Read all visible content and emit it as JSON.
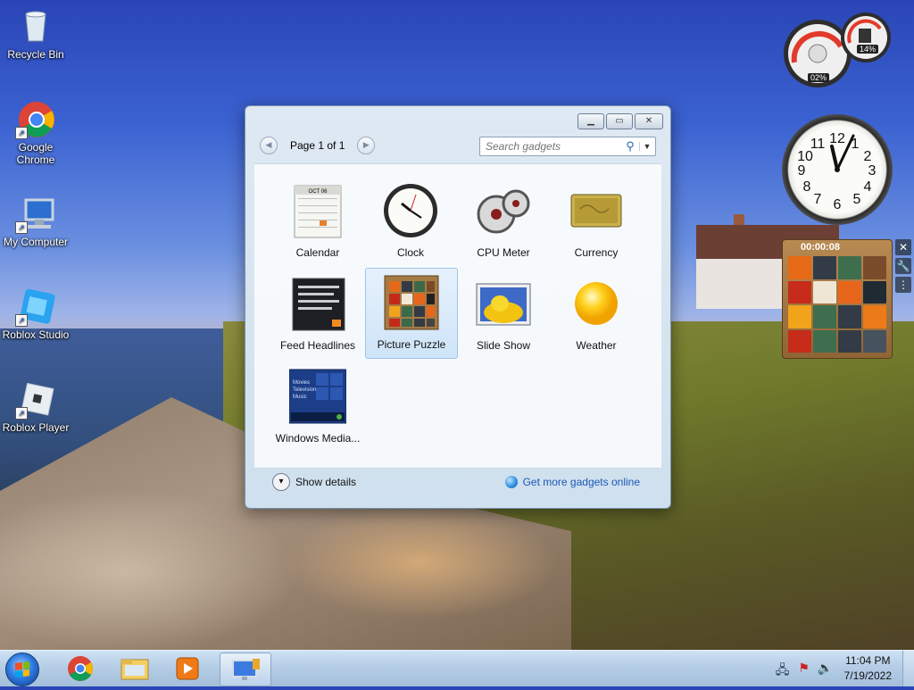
{
  "desktop": {
    "icons": [
      {
        "label": "Recycle Bin"
      },
      {
        "label": "Google Chrome"
      },
      {
        "label": "My Computer"
      },
      {
        "label": "Roblox Studio"
      },
      {
        "label": "Roblox Player"
      }
    ]
  },
  "gadget_window": {
    "pager": {
      "text": "Page 1 of 1"
    },
    "search": {
      "placeholder": "Search gadgets"
    },
    "gadgets": [
      {
        "label": "Calendar"
      },
      {
        "label": "Clock"
      },
      {
        "label": "CPU Meter"
      },
      {
        "label": "Currency"
      },
      {
        "label": "Feed Headlines"
      },
      {
        "label": "Picture Puzzle"
      },
      {
        "label": "Slide Show"
      },
      {
        "label": "Weather"
      },
      {
        "label": "Windows Media..."
      }
    ],
    "show_details": "Show details",
    "get_more": "Get more gadgets online",
    "calendar_month": "OCT 06",
    "media_lines": [
      "Movies",
      "Television",
      "Music"
    ]
  },
  "desktop_gadgets": {
    "cpu_meter": {
      "cpu": "02%",
      "memory": "14%"
    },
    "puzzle_timer": "00:00:08"
  },
  "taskbar": {
    "time": "11:04 PM",
    "date": "7/19/2022"
  },
  "colors": {
    "accent": "#1c57b6",
    "taskbar": "#b5cde6"
  }
}
